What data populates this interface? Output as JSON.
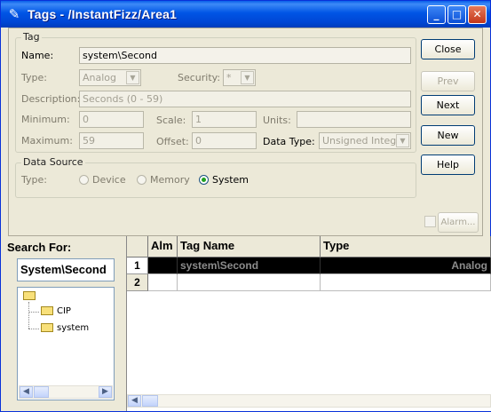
{
  "window": {
    "title": "Tags - /InstantFizz/Area1",
    "controls": {
      "minimize": "_",
      "maximize": "□",
      "close": "✕"
    },
    "icon": "pencil-icon"
  },
  "tag_group": {
    "title": "Tag",
    "name_label": "Name:",
    "name_value": "system\\Second",
    "type_label": "Type:",
    "type_value": "Analog",
    "security_label": "Security:",
    "security_value": "*",
    "description_label": "Description:",
    "description_value": "Seconds (0 - 59)",
    "minimum_label": "Minimum:",
    "minimum_value": "0",
    "scale_label": "Scale:",
    "scale_value": "1",
    "units_label": "Units:",
    "units_value": "",
    "maximum_label": "Maximum:",
    "maximum_value": "59",
    "offset_label": "Offset:",
    "offset_value": "0",
    "datatype_label": "Data Type:",
    "datatype_value": "Unsigned Integer"
  },
  "data_source": {
    "title": "Data Source",
    "type_label": "Type:",
    "options": [
      "Device",
      "Memory",
      "System"
    ],
    "selected": "System"
  },
  "buttons": {
    "close": "Close",
    "prev": "Prev",
    "next": "Next",
    "new": "New",
    "help": "Help",
    "alarm": "Alarm..."
  },
  "search": {
    "label": "Search For:",
    "value": "System\\Second"
  },
  "tree": {
    "items": [
      "CIP",
      "system"
    ]
  },
  "grid": {
    "columns": [
      "Alm",
      "Tag Name",
      "Type"
    ],
    "rows": [
      {
        "num": "1",
        "alm": "",
        "tag_name": "system\\Second",
        "type": "Analog"
      },
      {
        "num": "2",
        "alm": "",
        "tag_name": "",
        "type": ""
      }
    ]
  },
  "colors": {
    "title_bar": "#0055e5",
    "selected_row_bg": "#000000",
    "selected_row_text": "#8c8c8c"
  }
}
